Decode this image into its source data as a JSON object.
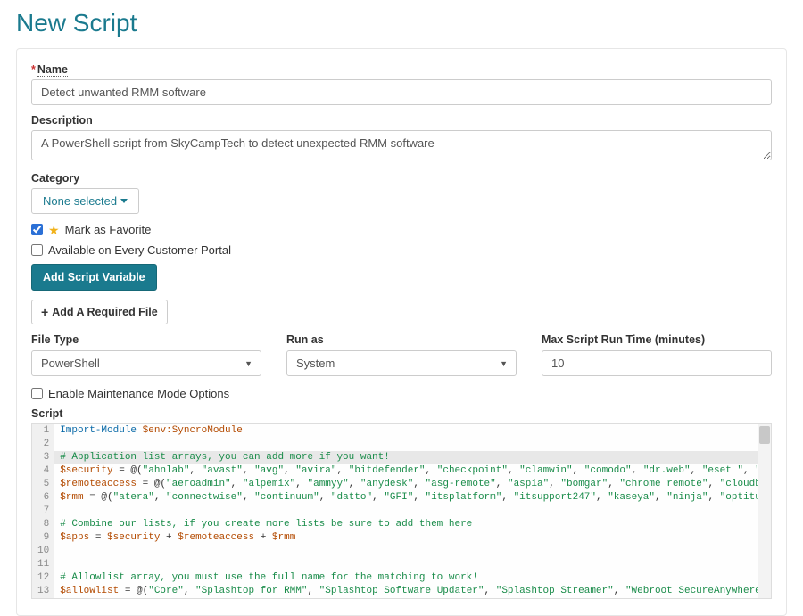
{
  "page": {
    "title": "New Script"
  },
  "form": {
    "name": {
      "label": "Name",
      "value": "Detect unwanted RMM software"
    },
    "description": {
      "label": "Description",
      "value": "A PowerShell script from SkyCampTech to detect unexpected RMM software"
    },
    "category": {
      "label": "Category",
      "selected": "None selected"
    },
    "favorite": {
      "label": "Mark as Favorite",
      "checked": true
    },
    "portal": {
      "label": "Available on Every Customer Portal",
      "checked": false
    },
    "buttons": {
      "add_variable": "Add Script Variable",
      "add_required_file": "Add A Required File"
    },
    "file_type": {
      "label": "File Type",
      "value": "PowerShell"
    },
    "run_as": {
      "label": "Run as",
      "value": "System"
    },
    "max_runtime": {
      "label": "Max Script Run Time (minutes)",
      "value": "10"
    },
    "maintenance": {
      "label": "Enable Maintenance Mode Options",
      "checked": false
    },
    "script_label": "Script"
  },
  "editor": {
    "lines": [
      "Import-Module $env:SyncroModule",
      "",
      "# Application list arrays, you can add more if you want!",
      "$security = @(\"ahnlab\", \"avast\", \"avg\", \"avira\", \"bitdefender\", \"checkpoint\", \"clamwin\", \"comodo\", \"dr.web\", \"eset \", \"fortinet\", \"f-prot\", \"f-secure\", \"g data\", \"immunet\", \"kaspersky\",",
      "$remoteaccess = @(\"aeroadmin\", \"alpemix\", \"ammyy\", \"anydesk\", \"asg-remote\", \"aspia\", \"bomgar\", \"chrome remote\", \"cloudberry remote\", \"dameware\", \"dayon\", \"deskroll\", \"dualmon\", \"dwservi",
      "$rmm = @(\"atera\", \"connectwise\", \"continuum\", \"datto\", \"GFI\", \"itsplatform\", \"itsupport247\", \"kaseya\", \"ninja\", \"optitune\", \"pulseway\", \"solarwinds\")",
      "",
      "# Combine our lists, if you create more lists be sure to add them here",
      "$apps = $security + $remoteaccess + $rmm",
      "",
      "",
      "# Allowlist array, you must use the full name for the matching to work!",
      "$allowlist = @(\"Core\", \"Splashtop for RMM\", \"Splashtop Software Updater\", \"Splashtop Streamer\", \"Webroot SecureAnywhere\", \"Samsung Data Migration\", \"GoTo Opener\")"
    ]
  }
}
